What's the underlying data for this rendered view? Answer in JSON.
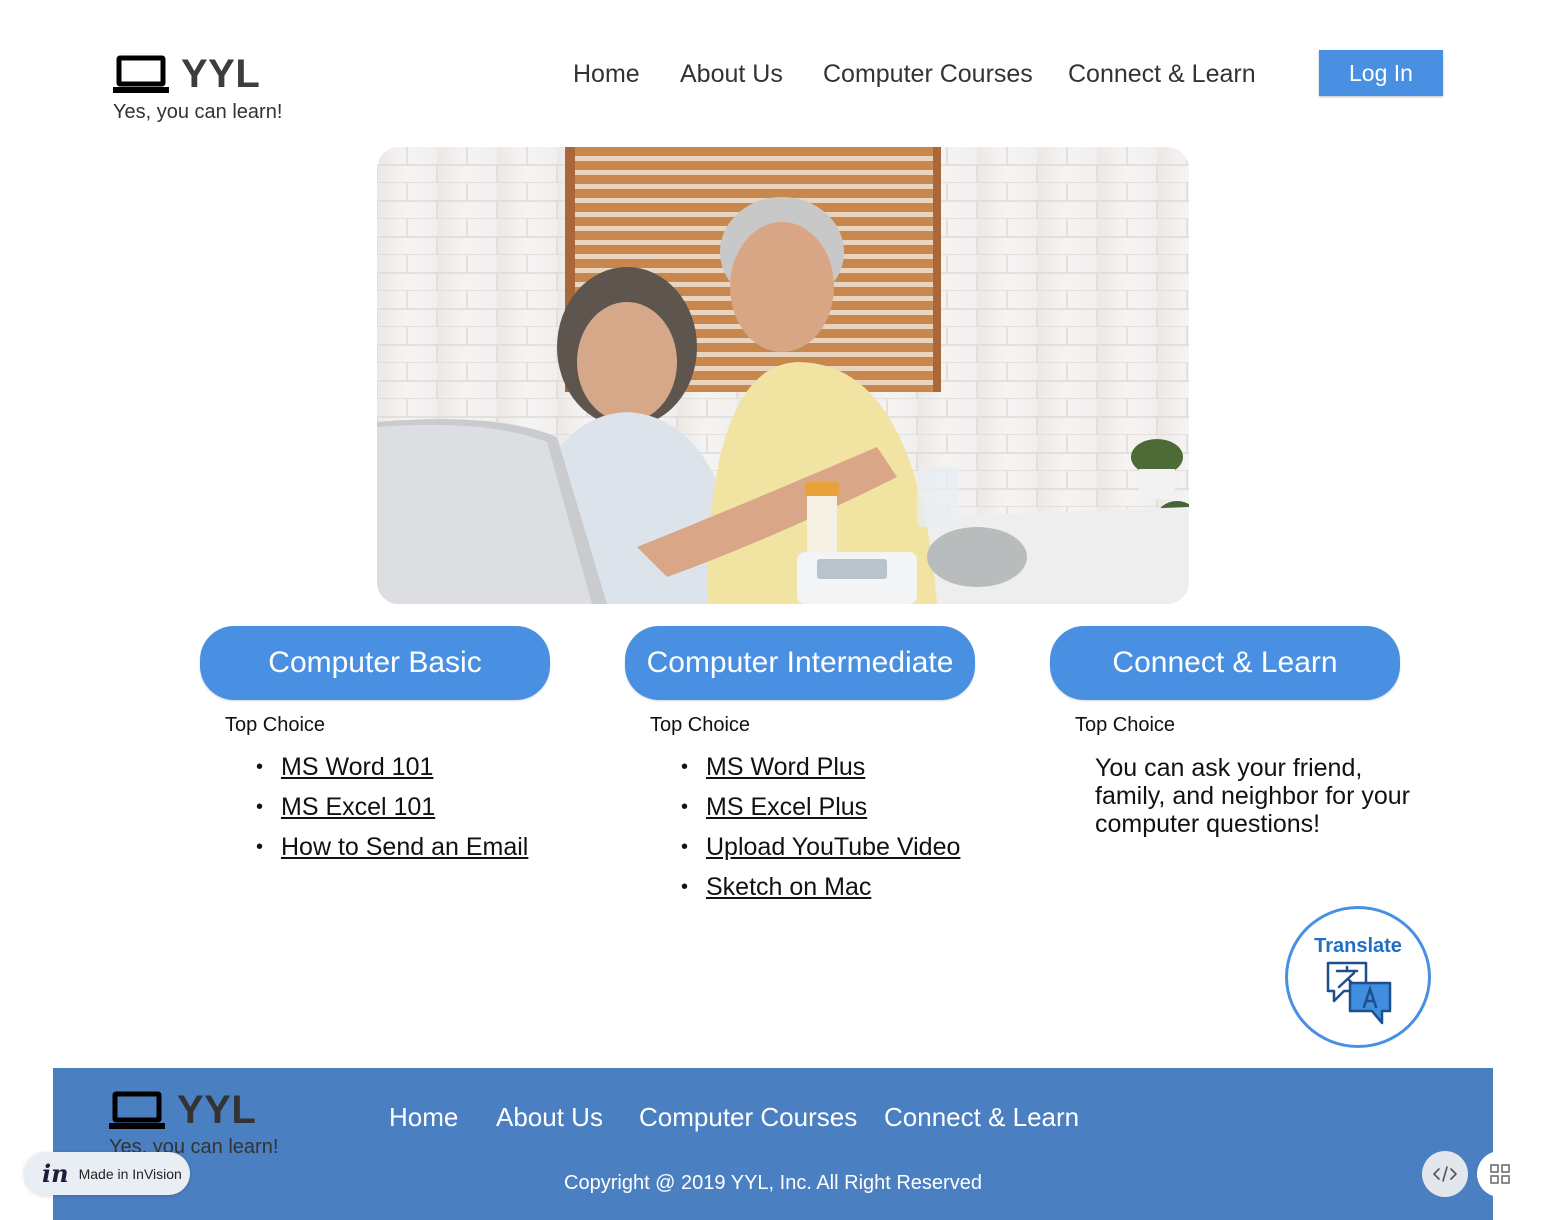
{
  "header": {
    "brand": "YYL",
    "tagline": "Yes, you can learn!",
    "nav": [
      "Home",
      "About Us",
      "Computer Courses",
      "Connect & Learn"
    ],
    "login_label": "Log In"
  },
  "hero": {
    "icon": "laptop-icon"
  },
  "columns": [
    {
      "title": "Computer Basic",
      "subtitle": "Top Choice",
      "links": [
        "MS Word 101",
        "MS Excel 101",
        "How to Send an Email"
      ]
    },
    {
      "title": "Computer Intermediate",
      "subtitle": "Top Choice",
      "links": [
        "MS Word Plus",
        "MS Excel Plus",
        "Upload YouTube Video",
        "Sketch on Mac"
      ]
    },
    {
      "title": "Connect & Learn",
      "subtitle": "Top Choice",
      "text": "You can ask your friend, family, and neighbor for your computer questions!"
    }
  ],
  "translate": {
    "label": "Translate",
    "icon": "translate-icon"
  },
  "footer": {
    "brand": "YYL",
    "tagline": "Yes, you can learn!",
    "nav": [
      "Home",
      "About Us",
      "Computer Courses",
      "Connect & Learn"
    ],
    "copyright": "Copyright @ 2019 YYL, Inc. All Right Reserved"
  },
  "invision": {
    "logo": "in",
    "label": "Made in InVision"
  },
  "colors": {
    "primary": "#4a90e2",
    "footer": "#4a7fc1",
    "translate_text": "#1f6fc5"
  }
}
